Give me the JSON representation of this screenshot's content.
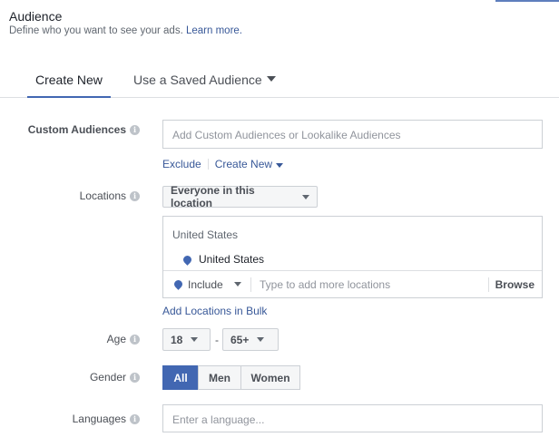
{
  "header": {
    "title": "Audience",
    "description": "Define who you want to see your ads.",
    "learn_more": "Learn more."
  },
  "tabs": [
    {
      "label": "Create New",
      "active": true
    },
    {
      "label": "Use a Saved Audience",
      "active": false
    }
  ],
  "custom_audiences": {
    "label": "Custom Audiences",
    "placeholder": "Add Custom Audiences or Lookalike Audiences",
    "exclude": "Exclude",
    "create_new": "Create New"
  },
  "locations": {
    "label": "Locations",
    "dropdown": "Everyone in this location",
    "country_header": "United States",
    "selected": "United States",
    "include": "Include",
    "placeholder": "Type to add more locations",
    "browse": "Browse",
    "bulk_link": "Add Locations in Bulk"
  },
  "age": {
    "label": "Age",
    "min": "18",
    "separator": "-",
    "max": "65+"
  },
  "gender": {
    "label": "Gender",
    "options": [
      "All",
      "Men",
      "Women"
    ],
    "selected": "All"
  },
  "languages": {
    "label": "Languages",
    "placeholder": "Enter a language..."
  },
  "colors": {
    "accent": "#4267b2",
    "link": "#385898"
  }
}
